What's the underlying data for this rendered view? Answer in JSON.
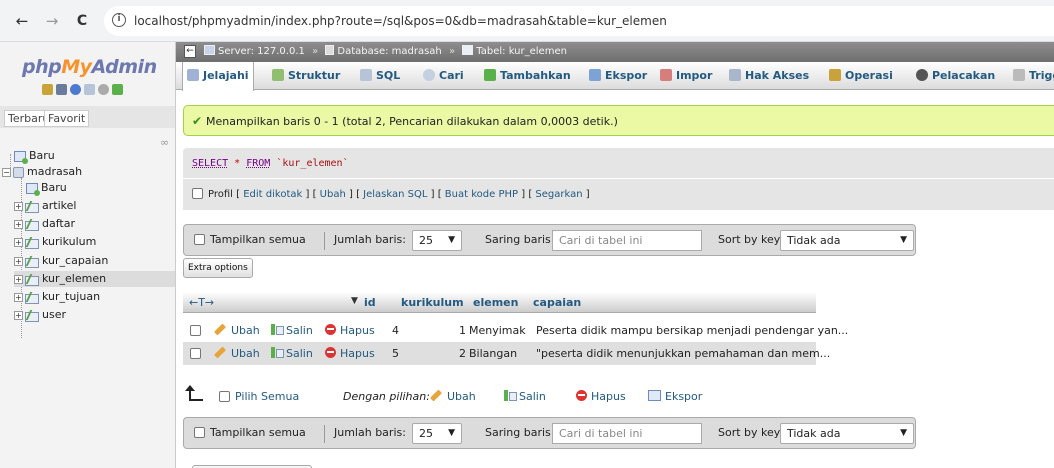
{
  "browser": {
    "back": "←",
    "forward": "→",
    "reload": "C",
    "url": "localhost/phpmyadmin/index.php?route=/sql&pos=0&db=madrasah&table=kur_elemen"
  },
  "logo": {
    "php": "php",
    "my": "My",
    "admin": "Admin"
  },
  "left_tabs": {
    "recent": "Terbaru",
    "favorite": "Favorit"
  },
  "tree": {
    "new_top": "Baru",
    "db": "madrasah",
    "new_in_db": "Baru",
    "tables": [
      "artikel",
      "daftar",
      "kurikulum",
      "kur_capaian",
      "kur_elemen",
      "kur_tujuan",
      "user"
    ],
    "selected_table": "kur_elemen"
  },
  "breadcrumb": {
    "server": "Server: 127.0.0.1",
    "database": "Database: madrasah",
    "table": "Tabel: kur_elemen"
  },
  "menu": [
    "Jelajahi",
    "Struktur",
    "SQL",
    "Cari",
    "Tambahkan",
    "Ekspor",
    "Impor",
    "Hak Akses",
    "Operasi",
    "Pelacakan",
    "Trigg"
  ],
  "success_message": "Menampilkan baris 0 - 1 (total 2, Pencarian dilakukan dalam 0,0003 detik.)",
  "sql": {
    "select": "SELECT",
    "star": "*",
    "from": "FROM",
    "table": "`kur_elemen`"
  },
  "sql_options": {
    "profile": "Profil",
    "links": [
      "Edit dikotak",
      "Ubah",
      "Jelaskan SQL",
      "Buat kode PHP",
      "Segarkan"
    ]
  },
  "nav": {
    "show_all": "Tampilkan semua",
    "rows_label": "Jumlah baris:",
    "rows_value": "25",
    "filter_label": "Saring baris:",
    "filter_placeholder": "Cari di tabel ini",
    "sort_label": "Sort by key:",
    "sort_value": "Tidak ada"
  },
  "extra_options": "Extra options",
  "table": {
    "arrows": "←T→",
    "sort_indicator": "▼",
    "columns": [
      "id",
      "kurikulum",
      "elemen",
      "capaian"
    ],
    "row_actions": {
      "edit": "Ubah",
      "copy": "Salin",
      "delete": "Hapus"
    },
    "rows": [
      {
        "id": "4",
        "kurikulum": "1",
        "elemen": "Menyimak",
        "capaian": "Peserta didik mampu bersikap menjadi pendengar yan..."
      },
      {
        "id": "5",
        "kurikulum": "2",
        "elemen": "Bilangan",
        "capaian": "\"peserta didik menunjukkan pemahaman dan mem..."
      }
    ]
  },
  "bulk": {
    "select_all": "Pilih Semua",
    "with_selected": "Dengan pilihan:",
    "edit": "Ubah",
    "copy": "Salin",
    "delete": "Hapus",
    "export": "Ekspor"
  }
}
